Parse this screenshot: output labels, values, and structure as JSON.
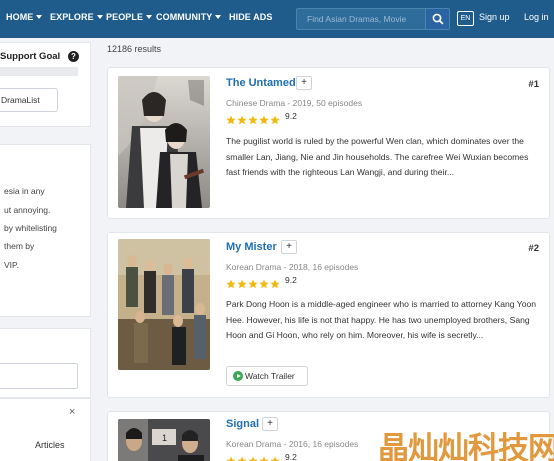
{
  "nav": {
    "items": [
      {
        "label": "HOME",
        "dropdown": true
      },
      {
        "label": "EXPLORE",
        "dropdown": true
      },
      {
        "label": "PEOPLE",
        "dropdown": true
      },
      {
        "label": "COMMUNITY",
        "dropdown": true
      },
      {
        "label": "HIDE ADS",
        "dropdown": false
      }
    ],
    "search_placeholder": "Find Asian Dramas, Movie",
    "lang": "EN",
    "signup": "Sign up",
    "login": "Log in"
  },
  "sidebar": {
    "support_title": "Support Goal",
    "dramalist_button": "DramaList",
    "notice_lines": [
      "esia in any",
      "ut annoying.",
      "by whitelisting",
      "them by",
      "VIP."
    ],
    "close": "×",
    "articles": "Articles"
  },
  "results": {
    "count_text": "12186 results",
    "items": [
      {
        "title": "The Untamed",
        "rank": "#1",
        "meta": "Chinese Drama - 2019, 50 episodes",
        "rating": "9.2",
        "rating_value": 9.2,
        "description": "The pugilist world is ruled by the powerful Wen clan, which dominates over the smaller Lan, Jiang, Nie and Jin households. The carefree Wei Wuxian becomes fast friends with the righteous Lan Wangji, and during their...",
        "trailer": ""
      },
      {
        "title": "My Mister",
        "rank": "#2",
        "meta": "Korean Drama - 2018, 16 episodes",
        "rating": "9.2",
        "rating_value": 9.2,
        "description": "Park Dong Hoon is a middle-aged engineer who is married to attorney Kang Yoon Hee. However, his life is not that happy. He has two unemployed brothers, Sang Hoon and Gi Hoon, who rely on him. Moreover, his wife is secretly...",
        "trailer": "Watch Trailer"
      },
      {
        "title": "Signal",
        "rank": "",
        "meta": "Korean Drama - 2016, 16 episodes",
        "rating": "9.2",
        "rating_value": 9.2,
        "description": "",
        "trailer": ""
      }
    ]
  },
  "watermark": "晶灿灿科技网",
  "colors": {
    "nav": "#1f5c8c",
    "link": "#1f6fb5",
    "star": "#f0b90b",
    "trailer_icon": "#3aa757",
    "watermark": "#e0902d"
  }
}
